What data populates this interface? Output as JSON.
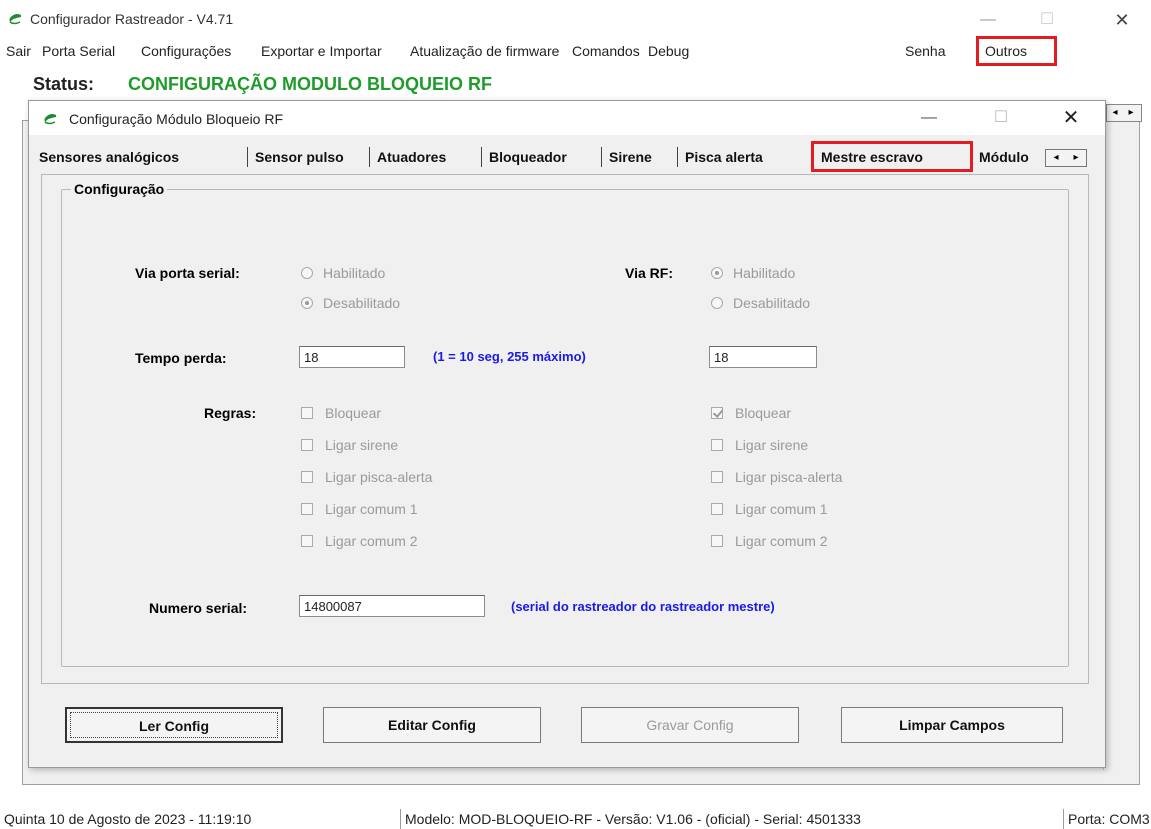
{
  "window": {
    "title": "Configurador Rastreador - V4.71",
    "min_icon": "—",
    "max_icon": "☐",
    "close_icon": "✕"
  },
  "menu": {
    "items": [
      "Sair",
      "Porta Serial",
      "Configurações",
      "Exportar e Importar",
      "Atualização de firmware",
      "Comandos",
      "Debug",
      "Senha",
      "Outros"
    ],
    "highlighted": "Outros"
  },
  "status": {
    "label": "Status:",
    "value": "CONFIGURAÇÃO MODULO BLOQUEIO RF",
    "color": "#1f9b2b"
  },
  "dialog": {
    "title": "Configuração Módulo Bloqueio RF",
    "min_icon": "—",
    "max_icon": "☐",
    "close_icon": "✕",
    "tabs": [
      "Sensores analógicos",
      "Sensor pulso",
      "Atuadores",
      "Bloqueador",
      "Sirene",
      "Pisca alerta",
      "Mestre escravo",
      "Módulo"
    ],
    "active_tab": "Mestre escravo",
    "tab_scroll_left": "◂",
    "tab_scroll_right": "▸",
    "group_title": "Configuração",
    "via_porta_serial": {
      "label": "Via porta serial:",
      "options": [
        "Habilitado",
        "Desabilitado"
      ],
      "selected": "Desabilitado"
    },
    "via_rf": {
      "label": "Via RF:",
      "options": [
        "Habilitado",
        "Desabilitado"
      ],
      "selected": "Habilitado"
    },
    "tempo_perda": {
      "label": "Tempo perda:",
      "serial_value": "18",
      "hint": "(1 = 10 seg, 255 máximo)",
      "rf_value": "18"
    },
    "regras": {
      "label": "Regras:",
      "serial": [
        {
          "label": "Bloquear",
          "checked": false
        },
        {
          "label": "Ligar sirene",
          "checked": false
        },
        {
          "label": "Ligar pisca-alerta",
          "checked": false
        },
        {
          "label": "Ligar comum 1",
          "checked": false
        },
        {
          "label": "Ligar comum 2",
          "checked": false
        }
      ],
      "rf": [
        {
          "label": "Bloquear",
          "checked": true
        },
        {
          "label": "Ligar sirene",
          "checked": false
        },
        {
          "label": "Ligar pisca-alerta",
          "checked": false
        },
        {
          "label": "Ligar comum 1",
          "checked": false
        },
        {
          "label": "Ligar comum 2",
          "checked": false
        }
      ]
    },
    "numero_serial": {
      "label": "Numero serial:",
      "value": "14800087",
      "hint": "(serial do rastreador do rastreador mestre)"
    },
    "buttons": {
      "ler": "Ler Config",
      "editar": "Editar Config",
      "gravar": "Gravar Config",
      "limpar": "Limpar Campos"
    }
  },
  "statusbar": {
    "datetime": "Quinta 10 de Agosto de 2023  -  11:19:10",
    "model": "Modelo: MOD-BLOQUEIO-RF  -  Versão: V1.06 - (oficial)  -  Serial: 4501333",
    "port": "Porta: COM3"
  },
  "colors": {
    "highlight": "#e31b23",
    "hint": "#1a1ae6",
    "disabled": "#9a9a9a"
  }
}
